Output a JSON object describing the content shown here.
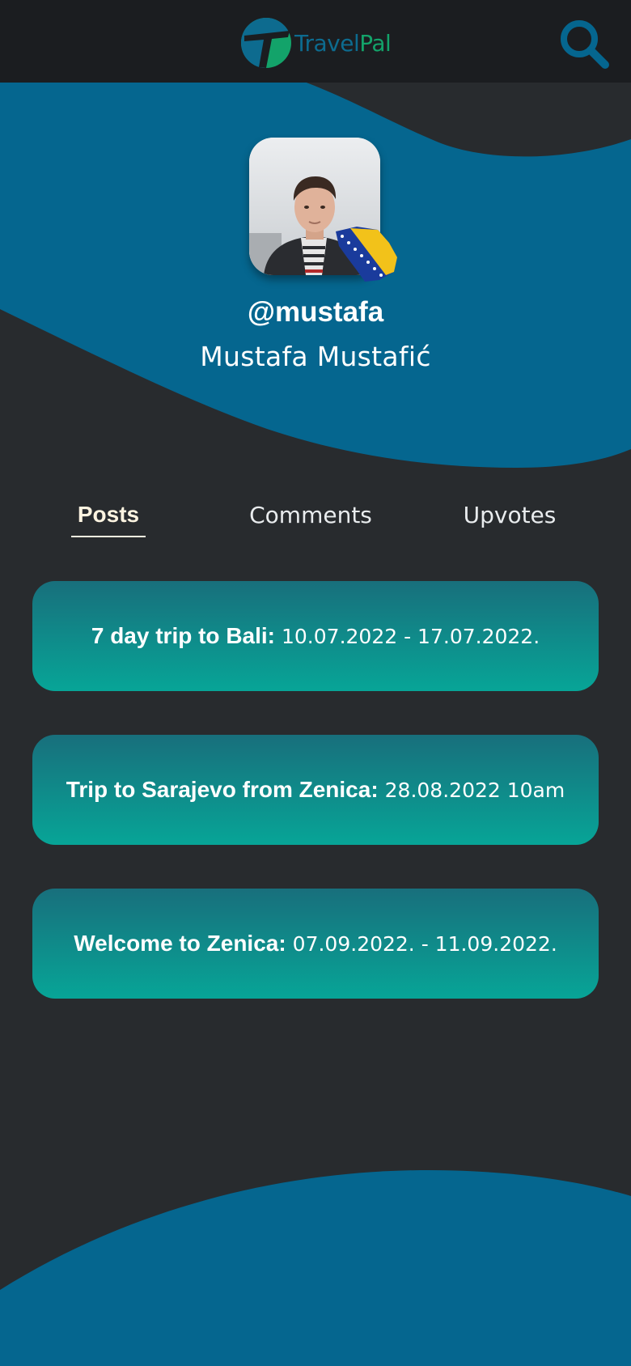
{
  "header": {
    "logo_text_part1": "Travel",
    "logo_text_part2": "Pal",
    "search_icon": "search-icon"
  },
  "profile": {
    "username": "@mustafa",
    "full_name": "Mustafa Mustafić",
    "avatar_icon": "user-photo",
    "badge_icon": "bosnia-flag-badge"
  },
  "tabs": [
    {
      "label": "Posts",
      "active": true
    },
    {
      "label": "Comments",
      "active": false
    },
    {
      "label": "Upvotes",
      "active": false
    }
  ],
  "posts": [
    {
      "title": "7 day trip to Bali:",
      "date": "10.07.2022 - 17.07.2022."
    },
    {
      "title": "Trip to Sarajevo from Zenica:",
      "date": "28.08.2022 10am"
    },
    {
      "title": "Welcome to Zenica:",
      "date": "07.09.2022. - 11.09.2022."
    }
  ],
  "colors": {
    "background": "#282b2e",
    "topbar": "#1b1d20",
    "wave_blue": "#05668f",
    "logo_blue": "#0d6b8f",
    "logo_green": "#13a36a",
    "card_gradient_top": "#186f7c",
    "card_gradient_bottom": "#07a597",
    "active_tab": "#fbf3e0"
  }
}
